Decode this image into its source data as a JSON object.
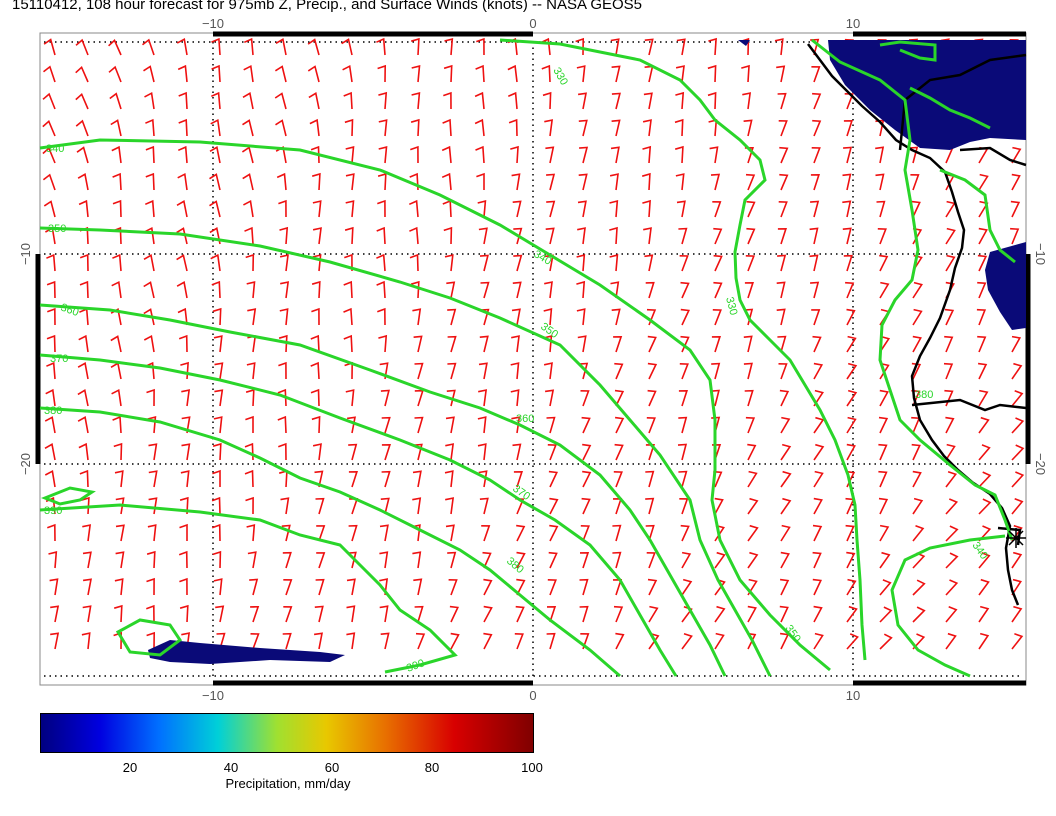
{
  "title": "15110412, 108 hour forecast for 975mb Z, Precip., and Surface Winds (knots) -- NASA GEOS5",
  "axes": {
    "top": [
      "−10",
      "0",
      "10"
    ],
    "bottom": [
      "−10",
      "0",
      "10"
    ],
    "left": [
      "−10",
      "−20"
    ],
    "right": [
      "−10",
      "−20"
    ]
  },
  "contour_labels": [
    "330",
    "340",
    "350",
    "360",
    "370",
    "380",
    "390"
  ],
  "colorbar": {
    "ticks": [
      "20",
      "40",
      "60",
      "80",
      "100"
    ],
    "label": "Precipitation, mm/day"
  },
  "colors": {
    "contour": "#2ad52a",
    "wind_barb": "#ee1111",
    "precip_low": "#0a0a78",
    "coast": "#000000"
  }
}
